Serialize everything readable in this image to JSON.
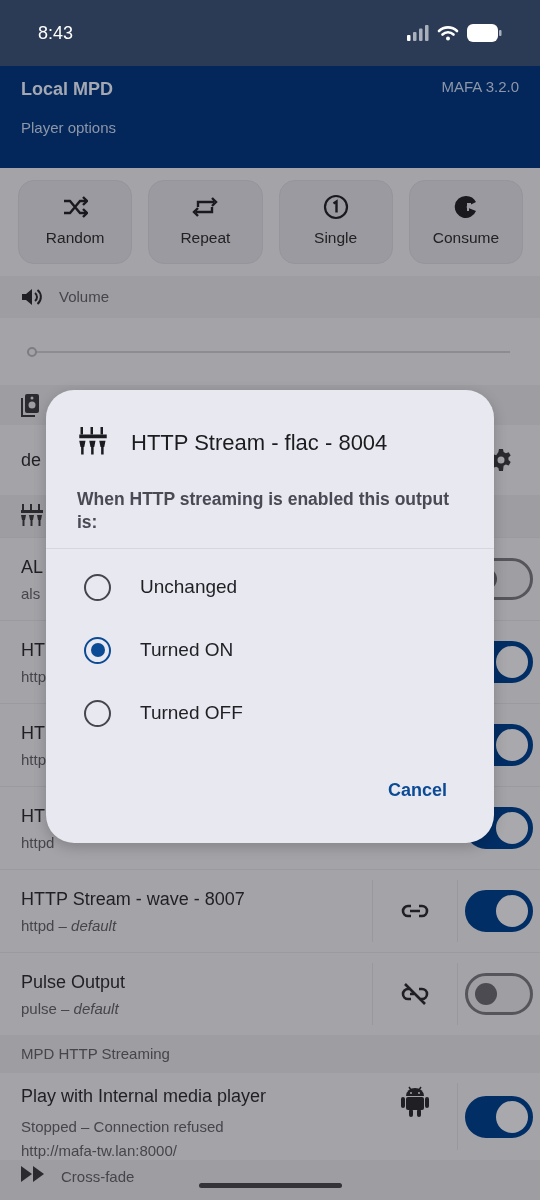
{
  "status_bar": {
    "time": "8:43"
  },
  "header": {
    "title": "Local MPD",
    "subtitle": "Player options",
    "version": "MAFA 3.2.0"
  },
  "mode_buttons": [
    {
      "kind": "random",
      "label": "Random"
    },
    {
      "kind": "repeat",
      "label": "Repeat"
    },
    {
      "kind": "single",
      "label": "Single"
    },
    {
      "kind": "consume",
      "label": "Consume"
    }
  ],
  "volume": {
    "label": "Volume",
    "level": 0
  },
  "device": {
    "name": "de"
  },
  "outputs": [
    {
      "name": "AL",
      "details": "als",
      "enabled": false
    },
    {
      "name": "HT",
      "details": "http",
      "enabled": true
    },
    {
      "name": "HT",
      "details": "http",
      "enabled": true
    },
    {
      "name": "HT",
      "details": "httpd",
      "enabled": true
    },
    {
      "name": "HTTP Stream - wave - 8007",
      "details": "httpd – *default*",
      "linked": true,
      "enabled": true
    },
    {
      "name": "Pulse Output",
      "details": "pulse – *default*",
      "linked": false,
      "enabled": false
    }
  ],
  "streaming": {
    "section": "MPD HTTP Streaming",
    "title": "Play with Internal media player",
    "status": "Stopped – Connection refused",
    "url": "http://mafa-tw.lan:8000/",
    "enabled": true
  },
  "crossfade": {
    "label": "Cross-fade"
  },
  "dialog": {
    "title": "HTTP Stream - flac - 8004",
    "message": "When HTTP streaming is enabled this output is:",
    "options": [
      {
        "label": "Unchanged",
        "selected": false
      },
      {
        "label": "Turned ON",
        "selected": true
      },
      {
        "label": "Turned OFF",
        "selected": false
      }
    ],
    "cancel": "Cancel"
  }
}
